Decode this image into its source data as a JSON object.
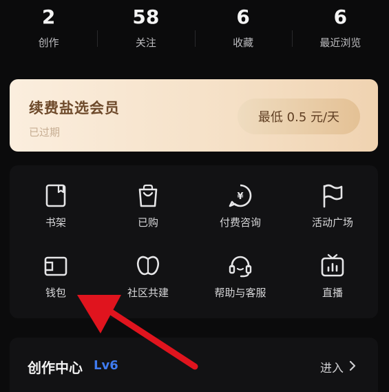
{
  "stats": [
    {
      "value": "2",
      "label": "创作"
    },
    {
      "value": "58",
      "label": "关注"
    },
    {
      "value": "6",
      "label": "收藏"
    },
    {
      "value": "6",
      "label": "最近浏览"
    }
  ],
  "vip": {
    "title": "续费盐选会员",
    "status": "已过期",
    "price_button": "最低 0.5 元/天"
  },
  "grid": [
    {
      "label": "书架",
      "icon": "bookshelf-icon"
    },
    {
      "label": "已购",
      "icon": "shopping-bag-icon"
    },
    {
      "label": "付费咨询",
      "icon": "paid-consult-icon"
    },
    {
      "label": "活动广场",
      "icon": "flag-icon"
    },
    {
      "label": "钱包",
      "icon": "wallet-icon"
    },
    {
      "label": "社区共建",
      "icon": "community-icon"
    },
    {
      "label": "帮助与客服",
      "icon": "headset-icon"
    },
    {
      "label": "直播",
      "icon": "live-tv-icon"
    }
  ],
  "creator": {
    "title": "创作中心",
    "level": "Lv6",
    "enter": "进入"
  },
  "colors": {
    "background": "#0b0b0c",
    "card": "#121214",
    "vip_gold": "#f0d3b1",
    "level_blue": "#3f7bf0",
    "annotation_arrow": "#e0141e"
  }
}
